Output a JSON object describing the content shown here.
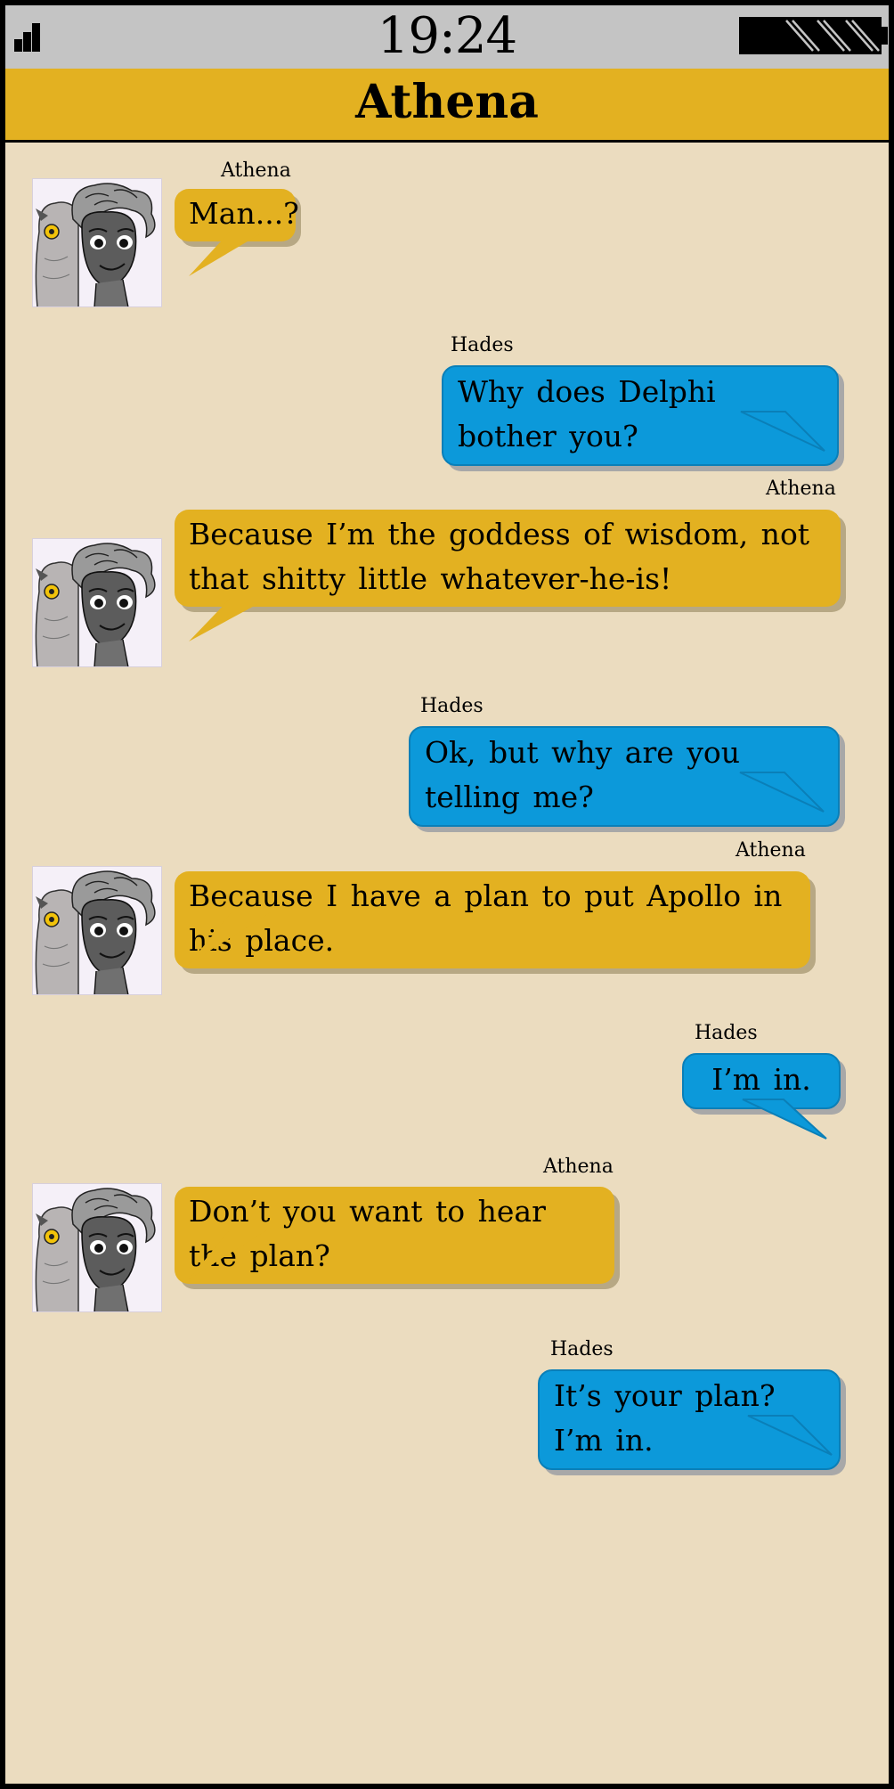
{
  "status": {
    "time": "19:24",
    "icons": [
      "signal-icon",
      "battery-icon"
    ]
  },
  "header": {
    "title": "Athena"
  },
  "colors": {
    "athena_bubble": "#e3b121",
    "hades_bubble": "#0c99da",
    "background": "#ebdcbf",
    "header": "#e3b121",
    "status_bar": "#c4c4c4"
  },
  "messages": [
    {
      "sender": "Athena",
      "side": "left",
      "text": "Man...?"
    },
    {
      "sender": "Hades",
      "side": "right",
      "text": "Why does Delphi bother you?"
    },
    {
      "sender": "Athena",
      "side": "left",
      "text": "Because I’m the goddess of wisdom, not that shitty little whatever-he-is!"
    },
    {
      "sender": "Hades",
      "side": "right",
      "text": "Ok, but why are you telling me?"
    },
    {
      "sender": "Athena",
      "side": "left",
      "text": "Because I have a plan to put Apollo in his place."
    },
    {
      "sender": "Hades",
      "side": "right",
      "text": "I’m in."
    },
    {
      "sender": "Athena",
      "side": "left",
      "text": "Don’t you want to hear the plan?"
    },
    {
      "sender": "Hades",
      "side": "right",
      "text": "It’s your plan? I’m in."
    }
  ]
}
